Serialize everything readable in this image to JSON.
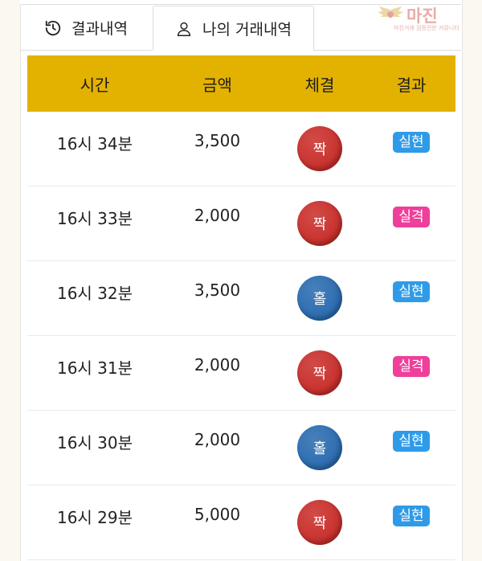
{
  "tabs": [
    {
      "label": "결과내역",
      "icon": "history-icon",
      "active": false
    },
    {
      "label": "나의 거래내역",
      "icon": "user-icon",
      "active": true
    }
  ],
  "table": {
    "headers": [
      "시간",
      "금액",
      "체결",
      "결과"
    ],
    "rows": [
      {
        "time": "16시 34분",
        "amount": "3,500",
        "bet": "짝",
        "bet_color": "#c9302c",
        "result": "실현",
        "result_color": "#2f9be8"
      },
      {
        "time": "16시 33분",
        "amount": "2,000",
        "bet": "짝",
        "bet_color": "#c9302c",
        "result": "실격",
        "result_color": "#ee3f9a"
      },
      {
        "time": "16시 32분",
        "amount": "3,500",
        "bet": "홀",
        "bet_color": "#2b6cb0",
        "result": "실현",
        "result_color": "#2f9be8"
      },
      {
        "time": "16시 31분",
        "amount": "2,000",
        "bet": "짝",
        "bet_color": "#c9302c",
        "result": "실격",
        "result_color": "#ee3f9a"
      },
      {
        "time": "16시 30분",
        "amount": "2,000",
        "bet": "홀",
        "bet_color": "#2b6cb0",
        "result": "실현",
        "result_color": "#2f9be8"
      },
      {
        "time": "16시 29분",
        "amount": "5,000",
        "bet": "짝",
        "bet_color": "#c9302c",
        "result": "실현",
        "result_color": "#2f9be8"
      }
    ]
  },
  "watermark": {
    "title": "마진",
    "subtitle": "마진거래 검증전문 커뮤니티"
  },
  "colors": {
    "header_bg": "#e3b100",
    "page_bg": "#fbf9ef"
  }
}
